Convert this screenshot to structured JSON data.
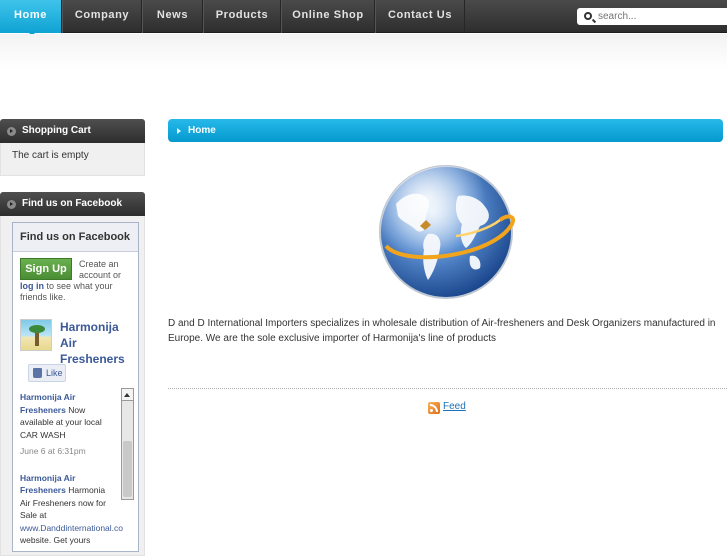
{
  "nav": {
    "items": [
      {
        "label": "Home",
        "active": true
      },
      {
        "label": "Company",
        "active": false
      },
      {
        "label": "News",
        "active": false
      },
      {
        "label": "Products",
        "active": false
      },
      {
        "label": "Online Shop",
        "active": false
      },
      {
        "label": "Contact Us",
        "active": false
      }
    ],
    "search_placeholder": "search..."
  },
  "sidebar": {
    "cart": {
      "title": "Shopping Cart",
      "text": "The cart is empty"
    },
    "facebook": {
      "title": "Find us on Facebook",
      "widget": {
        "header": "Find us on Facebook",
        "signup_label": "Sign Up",
        "create_text": "Create an account or",
        "login_label": "log in",
        "login_suffix": "to see what your friends like.",
        "page_name": "Harmonija Air Fresheners",
        "like_label": "Like",
        "posts": [
          {
            "author": "Harmonija Air Fresheners",
            "text": "Now available at your local CAR WASH",
            "date": "June 6 at 6:31pm"
          },
          {
            "author": "Harmonija Air Fresheners",
            "text": "Harmonia Air Fresheners now for Sale at",
            "link": "www.Danddinternational.co",
            "tail": "website. Get yours"
          }
        ]
      }
    }
  },
  "main": {
    "heading": "Home",
    "intro": "D and D International Importers specializes in wholesale distribution of Air-fresheners and Desk Organizers manufactured in Europe. We are the sole exclusive importer of Harmonija's line of products",
    "feed_label": "Feed"
  },
  "colors": {
    "accent": "#0ea2d2",
    "nav_bg": "#3a3a3a",
    "facebook_blue": "#3b5998"
  }
}
